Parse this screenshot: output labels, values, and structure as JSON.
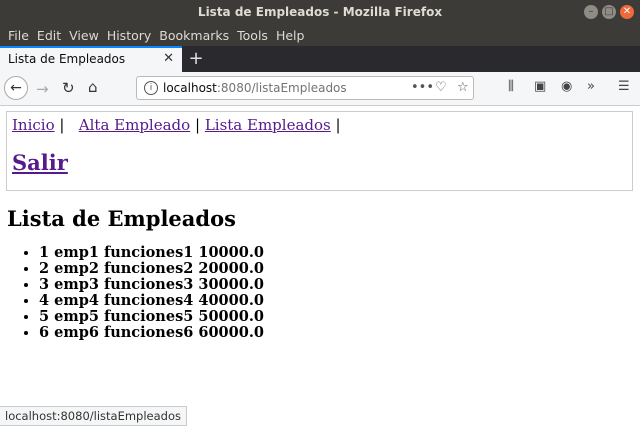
{
  "window": {
    "title": "Lista de Empleados - Mozilla Firefox"
  },
  "menu": [
    "File",
    "Edit",
    "View",
    "History",
    "Bookmarks",
    "Tools",
    "Help"
  ],
  "tab": {
    "label": "Lista de Empleados"
  },
  "url": {
    "host": "localhost",
    "path": ":8080/listaEmpleados"
  },
  "page": {
    "nav": {
      "inicio": "Inicio",
      "alta": "Alta Empleado",
      "lista": "Lista Empleados",
      "sep": "|"
    },
    "salir": "Salir",
    "title": "Lista de Empleados",
    "employees": [
      "1 emp1 funciones1 10000.0",
      "2 emp2 funciones2 20000.0",
      "3 emp3 funciones3 30000.0",
      "4 emp4 funciones4 40000.0",
      "5 emp5 funciones5 50000.0",
      "6 emp6 funciones6 60000.0"
    ]
  },
  "status": "localhost:8080/listaEmpleados",
  "colors": {
    "link": "#551a8b",
    "tab_accent": "#0a84ff",
    "titlebar": "#3c3b37"
  }
}
